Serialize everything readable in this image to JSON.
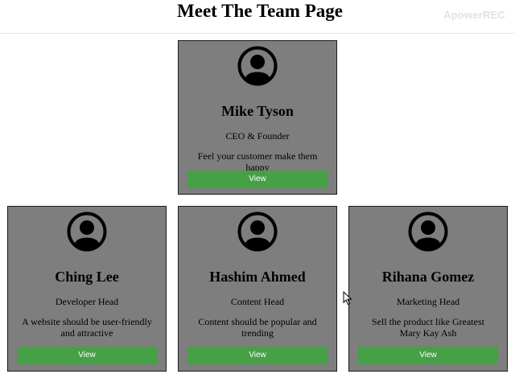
{
  "header": {
    "title": "Meet The Team Page",
    "watermark": "ApowerREC"
  },
  "members": [
    {
      "name": "Mike Tyson",
      "role": "CEO & Founder",
      "description": "Feel your customer make them happy",
      "button_label": "View",
      "avatar_icon": "user-circle-icon"
    },
    {
      "name": "Ching Lee",
      "role": "Developer Head",
      "description": "A website should be user-friendly and attractive",
      "button_label": "View",
      "avatar_icon": "user-circle-icon"
    },
    {
      "name": "Hashim Ahmed",
      "role": "Content Head",
      "description": "Content should be popular and trending",
      "button_label": "View",
      "avatar_icon": "user-circle-icon"
    },
    {
      "name": "Rihana Gomez",
      "role": "Marketing Head",
      "description": "Sell the product like Greatest Mary Kay Ash",
      "button_label": "View",
      "avatar_icon": "user-circle-icon"
    }
  ],
  "colors": {
    "card_background": "#7f7e7e",
    "button_background": "#46a046",
    "button_text": "#ffffff"
  }
}
